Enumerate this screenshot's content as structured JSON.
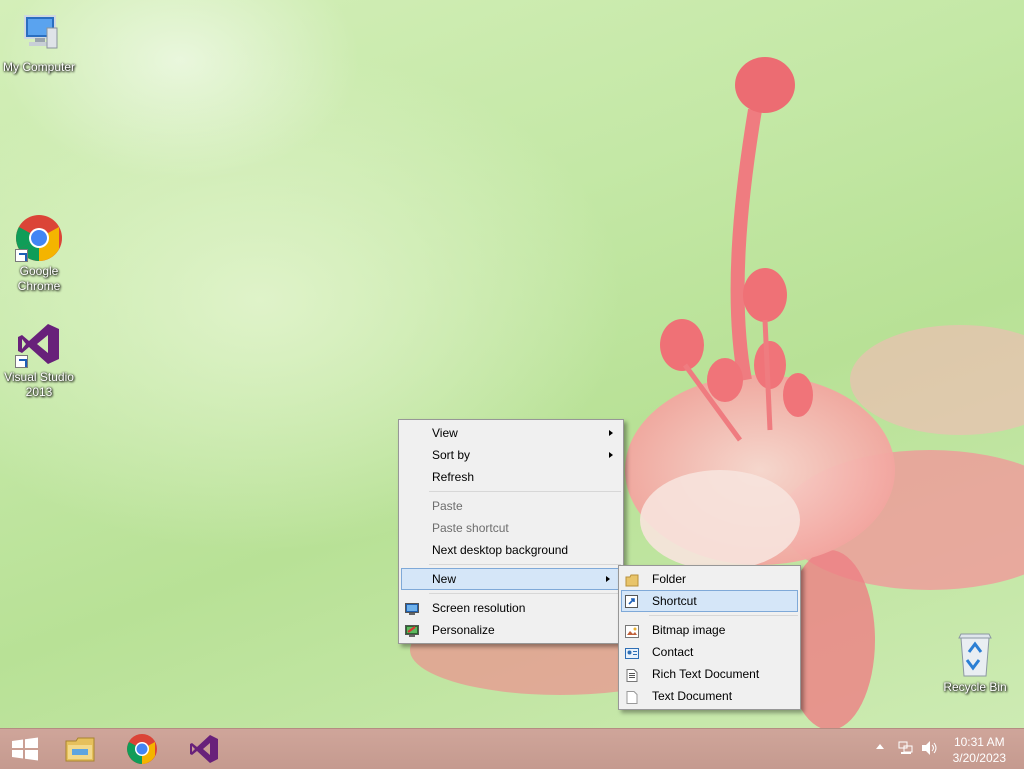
{
  "desktop": {
    "icons": [
      {
        "label": "My Computer",
        "icon": "computer-icon"
      },
      {
        "label": "Google\nChrome",
        "icon": "chrome-icon"
      },
      {
        "label": "Visual Studio\n2013",
        "icon": "visual-studio-icon"
      },
      {
        "label": "Recycle Bin",
        "icon": "recycle-bin-icon"
      }
    ]
  },
  "context_menu": {
    "items": [
      {
        "label": "View",
        "submenu": true
      },
      {
        "label": "Sort by",
        "submenu": true
      },
      {
        "label": "Refresh"
      },
      {
        "label": "Paste",
        "disabled": true
      },
      {
        "label": "Paste shortcut",
        "disabled": true
      },
      {
        "label": "Next desktop background"
      },
      {
        "label": "New",
        "submenu": true,
        "highlighted": true
      },
      {
        "label": "Screen resolution",
        "icon": "screen-resolution-icon"
      },
      {
        "label": "Personalize",
        "icon": "personalize-icon"
      }
    ]
  },
  "new_submenu": {
    "items": [
      {
        "label": "Folder",
        "icon": "folder-icon"
      },
      {
        "label": "Shortcut",
        "icon": "shortcut-icon",
        "highlighted": true
      },
      {
        "label": "Bitmap image",
        "icon": "bitmap-icon"
      },
      {
        "label": "Contact",
        "icon": "contact-icon"
      },
      {
        "label": "Rich Text Document",
        "icon": "rich-text-icon"
      },
      {
        "label": "Text Document",
        "icon": "text-document-icon"
      }
    ]
  },
  "taskbar": {
    "apps": [
      "start-icon",
      "file-explorer-icon",
      "chrome-icon",
      "visual-studio-icon"
    ],
    "clock": {
      "time": "10:31 AM",
      "date": "3/20/2023"
    }
  },
  "colors": {
    "menu_highlight": "#d5e6f8",
    "taskbar": "#c89e93",
    "flower": "#f0747a"
  }
}
